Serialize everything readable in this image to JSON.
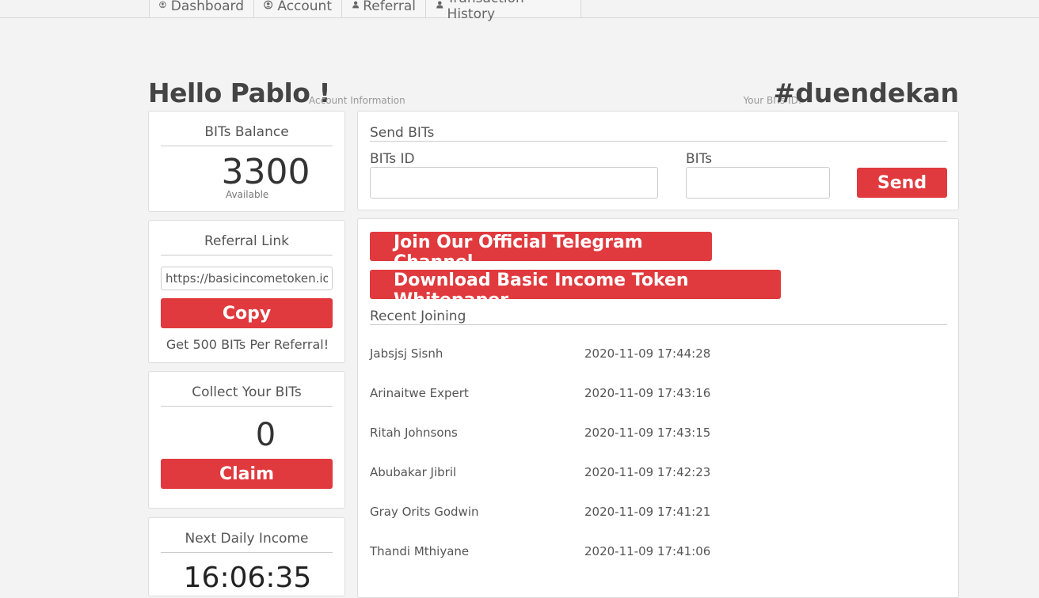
{
  "nav": {
    "tabs": [
      {
        "label": "Dashboard",
        "icon": "user-circle-icon"
      },
      {
        "label": "Account",
        "icon": "user-circle-icon"
      },
      {
        "label": "Referral",
        "icon": "user-icon"
      },
      {
        "label": "Transaction History",
        "icon": "user-icon"
      }
    ]
  },
  "header": {
    "greeting": "Hello Pablo !",
    "subtitle": "Account Information",
    "bits_id_label": "Your BITs ID:",
    "bits_id": "#duendekan"
  },
  "balance": {
    "title": "BITs Balance",
    "value": "3300",
    "caption": "Available"
  },
  "referral": {
    "title": "Referral Link",
    "link": "https://basicincometoken.io",
    "copy_label": "Copy",
    "note": "Get 500 BITs Per Referral!"
  },
  "collect": {
    "title": "Collect Your BITs",
    "value": "0",
    "claim_label": "Claim"
  },
  "next_income": {
    "title": "Next Daily Income",
    "countdown": "16:06:35"
  },
  "send": {
    "title": "Send BITs",
    "id_label": "BITs ID",
    "id_value": "",
    "amount_label": "BITs",
    "amount_value": "",
    "send_label": "Send"
  },
  "links": {
    "telegram_label": "Join Our Official Telegram Channel",
    "whitepaper_label": "Download Basic Income Token Whitepaper"
  },
  "recent": {
    "title": "Recent Joining",
    "rows": [
      {
        "name": "Jabsjsj Sisnh",
        "date": "2020-11-09 17:44:28"
      },
      {
        "name": "Arinaitwe Expert",
        "date": "2020-11-09 17:43:16"
      },
      {
        "name": "Ritah Johnsons",
        "date": "2020-11-09 17:43:15"
      },
      {
        "name": "Abubakar Jibril",
        "date": "2020-11-09 17:42:23"
      },
      {
        "name": "Gray Orits Godwin",
        "date": "2020-11-09 17:41:21"
      },
      {
        "name": "Thandi Mthiyane",
        "date": "2020-11-09 17:41:06"
      }
    ]
  },
  "colors": {
    "accent": "#e03a3e",
    "background": "#f3f3f3"
  }
}
